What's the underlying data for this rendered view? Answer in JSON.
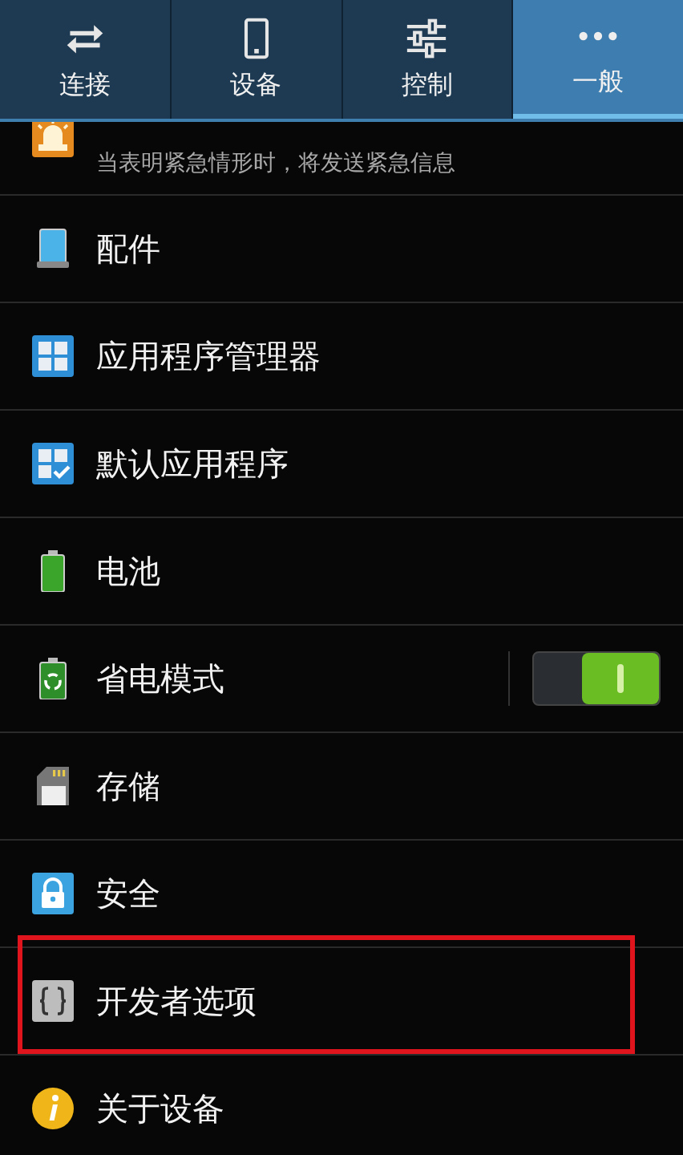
{
  "tabs": [
    {
      "label": "连接",
      "selected": false
    },
    {
      "label": "设备",
      "selected": false
    },
    {
      "label": "控制",
      "selected": false
    },
    {
      "label": "一般",
      "selected": true
    }
  ],
  "items": [
    {
      "kind": "plain",
      "subtitle": "当表明紧急情形时，将发送紧急信息",
      "highlighted": false
    },
    {
      "kind": "plain",
      "title": "配件",
      "highlighted": false
    },
    {
      "kind": "plain",
      "title": "应用程序管理器",
      "highlighted": false
    },
    {
      "kind": "plain",
      "title": "默认应用程序",
      "highlighted": false
    },
    {
      "kind": "plain",
      "title": "电池",
      "highlighted": false
    },
    {
      "kind": "toggle",
      "title": "省电模式",
      "on": true,
      "highlighted": false
    },
    {
      "kind": "plain",
      "title": "存储",
      "highlighted": false
    },
    {
      "kind": "plain",
      "title": "安全",
      "highlighted": false
    },
    {
      "kind": "plain",
      "title": "开发者选项",
      "highlighted": true
    },
    {
      "kind": "plain",
      "title": "关于设备",
      "highlighted": false
    }
  ]
}
